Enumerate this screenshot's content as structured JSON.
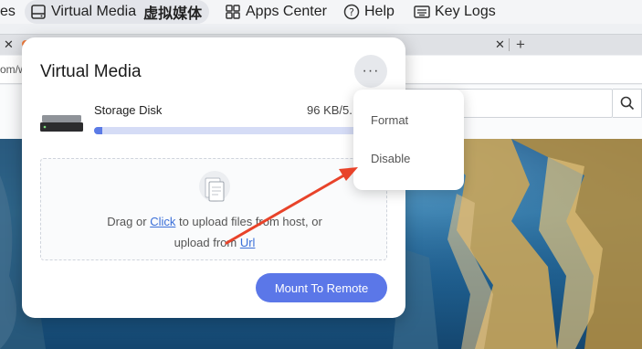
{
  "toolbar": {
    "partial_label": "es",
    "virtual_media_label": "Virtual Media",
    "virtual_media_cn": "虚拟媒体",
    "apps_center_label": "Apps Center",
    "help_label": "Help",
    "key_logs_label": "Key Logs"
  },
  "browser": {
    "address_text": "om/w"
  },
  "dialog": {
    "title": "Virtual Media",
    "more_label": "···",
    "disk_name": "Storage Disk",
    "disk_speed": "96 KB/5.",
    "progress": 0.03,
    "drop_prefix": "Drag or ",
    "drop_click": "Click",
    "drop_mid": " to upload files from host, or",
    "drop_line2_prefix": "upload from ",
    "drop_url": "Url",
    "mount_button": "Mount To Remote"
  },
  "menu": {
    "items": [
      "Format",
      "Disable"
    ]
  },
  "colors": {
    "accent": "#5b77e8",
    "link": "#3a6fd8",
    "arrow": "#e8432a"
  }
}
